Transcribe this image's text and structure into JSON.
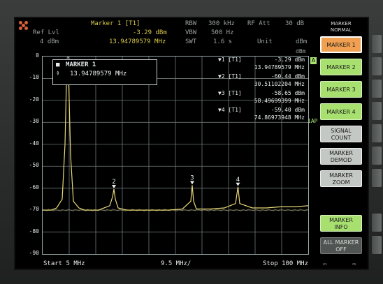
{
  "header": {
    "marker_title": "Marker 1 [T1]",
    "ref_label": "Ref Lvl",
    "ref_value": "4 dBm",
    "marker_level": "-3.29 dBm",
    "marker_freq": "13.94789579 MHz",
    "rbw_label": "RBW",
    "rbw_value": "300 kHz",
    "vbw_label": "VBW",
    "vbw_value": "500 Hz",
    "swt_label": "SWT",
    "swt_value": "1.6 s",
    "rfatt_label": "RF Att",
    "rfatt_value": "30 dB",
    "unit_label": "Unit",
    "unit_value": "dBm",
    "unit_right": "dBm",
    "a_badge": "A",
    "trace_badge": "1AP"
  },
  "marker_box": {
    "title": "MARKER 1",
    "freq": "13.94789579 MHz"
  },
  "marker_table": [
    {
      "id": "▼1 [T1]",
      "level": "-3.29 dBm",
      "freq": "13.94789579 MHz"
    },
    {
      "id": "▼2 [T1]",
      "level": "-60.44 dBm",
      "freq": "30.51102204 MHz"
    },
    {
      "id": "▼3 [T1]",
      "level": "-58.65 dBm",
      "freq": "58.49699399 MHz"
    },
    {
      "id": "▼4 [T1]",
      "level": "-59.40 dBm",
      "freq": "74.86973948 MHz"
    }
  ],
  "footer": {
    "start": "Start 5 MHz",
    "span": "9.5 MHz/",
    "stop": "Stop 100 MHz"
  },
  "side_header": [
    "MARKER",
    "NORMAL"
  ],
  "softkeys": [
    {
      "lines": [
        "MARKER 1"
      ],
      "style": "orange"
    },
    {
      "lines": [
        "MARKER 2"
      ],
      "style": "green"
    },
    {
      "lines": [
        "MARKER 3"
      ],
      "style": "green"
    },
    {
      "lines": [
        "MARKER 4"
      ],
      "style": "green"
    },
    {
      "lines": [
        "SIGNAL",
        "COUNT"
      ],
      "style": "gray"
    },
    {
      "lines": [
        "MARKER",
        "DEMOD"
      ],
      "style": "gray"
    },
    {
      "lines": [
        "MARKER",
        "ZOOM"
      ],
      "style": "gray"
    },
    {
      "lines": [
        "MARKER",
        "INFO"
      ],
      "style": "green"
    },
    {
      "lines": [
        "ALL MARKER",
        "OFF"
      ],
      "style": "dark"
    }
  ],
  "chart_data": {
    "type": "line",
    "xlabel": "",
    "ylabel": "",
    "xlim": [
      5,
      100
    ],
    "ylim": [
      -90,
      0
    ],
    "y_ticks": [
      "0",
      "-10",
      "-20",
      "-30",
      "-40",
      "-50",
      "-60",
      "-70",
      "-80",
      "-90"
    ],
    "grid": true,
    "noise_floor": -70,
    "series": [
      {
        "x": [
          5,
          8,
          10,
          12,
          13,
          13.5,
          13.95,
          14.4,
          15,
          16,
          18,
          20,
          25,
          29,
          30,
          30.5,
          31,
          32,
          35,
          40,
          45,
          50,
          55,
          58,
          58.5,
          59,
          60,
          65,
          70,
          74,
          74.87,
          75.5,
          80,
          85,
          90,
          95,
          100
        ],
        "y": [
          -70,
          -70,
          -69,
          -65,
          -40,
          -12,
          -3.29,
          -15,
          -45,
          -66,
          -69,
          -70,
          -70,
          -68,
          -64,
          -60.44,
          -65,
          -69,
          -70,
          -70,
          -70,
          -70,
          -69.5,
          -66,
          -58.65,
          -66,
          -69.5,
          -69.5,
          -69,
          -67,
          -59.4,
          -67,
          -69,
          -69,
          -68.5,
          -68.5,
          -68
        ]
      }
    ],
    "markers": [
      {
        "label": "1",
        "x": 13.95,
        "y": -3.29
      },
      {
        "label": "2",
        "x": 30.51,
        "y": -60.44
      },
      {
        "label": "3",
        "x": 58.5,
        "y": -58.65
      },
      {
        "label": "4",
        "x": 74.87,
        "y": -59.4
      }
    ],
    "colors": {
      "trace": "#e8d878",
      "grid": "#6f7777"
    }
  }
}
